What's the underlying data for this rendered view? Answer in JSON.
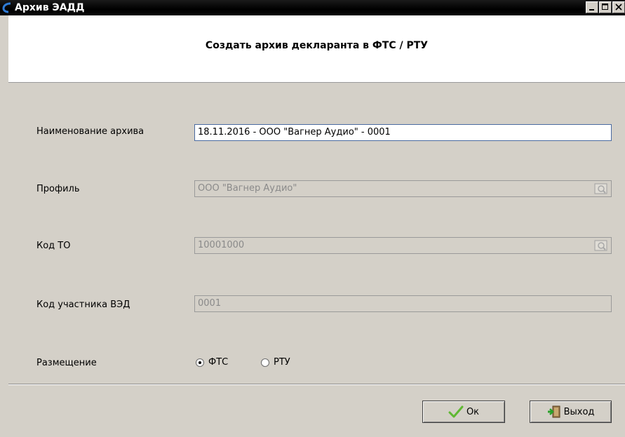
{
  "window": {
    "title": "Архив ЭАДД",
    "icon": "app-logo-icon",
    "controls": [
      "minimize-icon",
      "maximize-icon",
      "close-icon"
    ]
  },
  "header": {
    "title": "Создать архив декларанта в ФТС / РТУ"
  },
  "form": {
    "archive_name": {
      "label": "Наименование архива",
      "value": "18.11.2016 - ООО \"Вагнер Аудио\" - 0001"
    },
    "profile": {
      "label": "Профиль",
      "value": "ООО \"Вагнер Аудио\"",
      "icon": "lookup-icon"
    },
    "customs_code": {
      "label": "Код ТО",
      "value": "10001000",
      "icon": "lookup-icon"
    },
    "participant_code": {
      "label": "Код участника ВЭД",
      "value": "0001"
    },
    "placement": {
      "label": "Размещение",
      "options": [
        {
          "label": "ФТС",
          "selected": true
        },
        {
          "label": "РТУ",
          "selected": false
        }
      ]
    }
  },
  "buttons": {
    "ok_label": "Ок",
    "exit_label": "Выход",
    "ok_icon": "checkmark-icon",
    "exit_icon": "exit-door-icon"
  }
}
